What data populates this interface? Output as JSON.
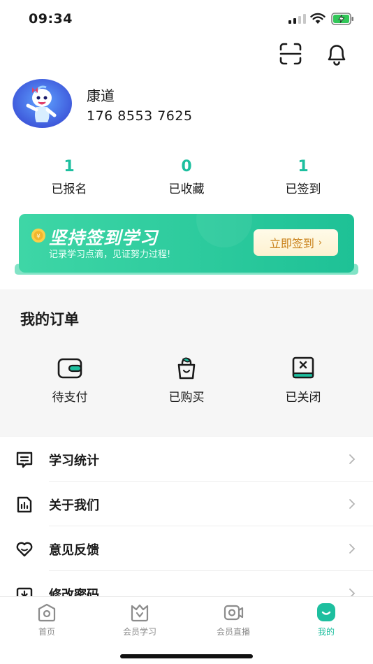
{
  "status_bar": {
    "time": "09:34"
  },
  "user": {
    "name": "康道",
    "phone": "176 8553 7625"
  },
  "stats": [
    {
      "count": "1",
      "label": "已报名"
    },
    {
      "count": "0",
      "label": "已收藏"
    },
    {
      "count": "1",
      "label": "已签到"
    }
  ],
  "banner": {
    "title": "坚持签到学习",
    "subtitle": "记录学习点滴，见证努力过程!",
    "button_label": "立即签到",
    "button_arrow": "›"
  },
  "orders": {
    "title": "我的订单",
    "items": [
      {
        "label": "待支付",
        "icon": "wallet-icon"
      },
      {
        "label": "已购买",
        "icon": "shopping-bag-icon"
      },
      {
        "label": "已关闭",
        "icon": "closed-book-icon"
      }
    ]
  },
  "menu": [
    {
      "label": "学习统计",
      "icon": "study-stats-icon"
    },
    {
      "label": "关于我们",
      "icon": "about-us-icon"
    },
    {
      "label": "意见反馈",
      "icon": "feedback-icon"
    },
    {
      "label": "修改密码",
      "icon": "change-password-icon"
    }
  ],
  "tabs": [
    {
      "label": "首页",
      "icon": "home-icon",
      "active": false
    },
    {
      "label": "会员学习",
      "icon": "member-study-icon",
      "active": false
    },
    {
      "label": "会员直播",
      "icon": "member-live-icon",
      "active": false
    },
    {
      "label": "我的",
      "icon": "profile-icon",
      "active": true
    }
  ],
  "colors": {
    "accent": "#1dbf9f",
    "banner_start": "#3ed6a6",
    "banner_end": "#1ec196",
    "button_text": "#c9811a",
    "tab_inactive": "#8c8c8c"
  }
}
